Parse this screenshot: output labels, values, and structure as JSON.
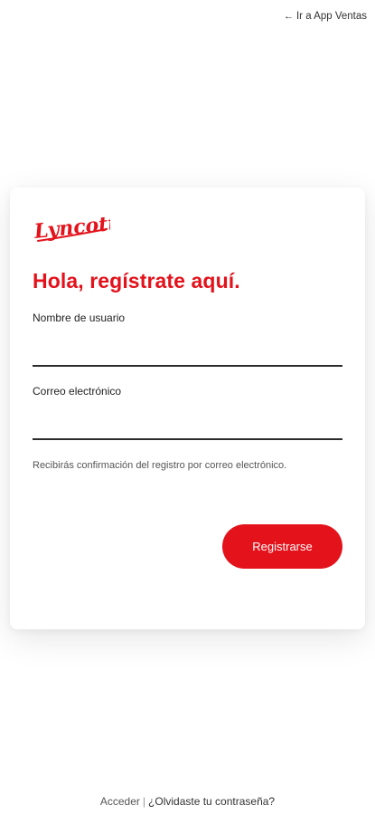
{
  "header": {
    "back_link_arrow": "←",
    "back_link_label": "Ir a App Ventas"
  },
  "brand": {
    "logo_text": "Lyncott",
    "accent_color": "#e3121b"
  },
  "form": {
    "title": "Hola, regístrate aquí.",
    "username_label": "Nombre de usuario",
    "username_value": "",
    "email_label": "Correo electrónico",
    "email_value": "",
    "info_text": "Recibirás confirmación del registro por correo electrónico.",
    "submit_label": "Registrarse"
  },
  "footer": {
    "login_link": "Acceder",
    "separator": "|",
    "forgot_link": "¿Olvidaste tu contraseña?"
  }
}
